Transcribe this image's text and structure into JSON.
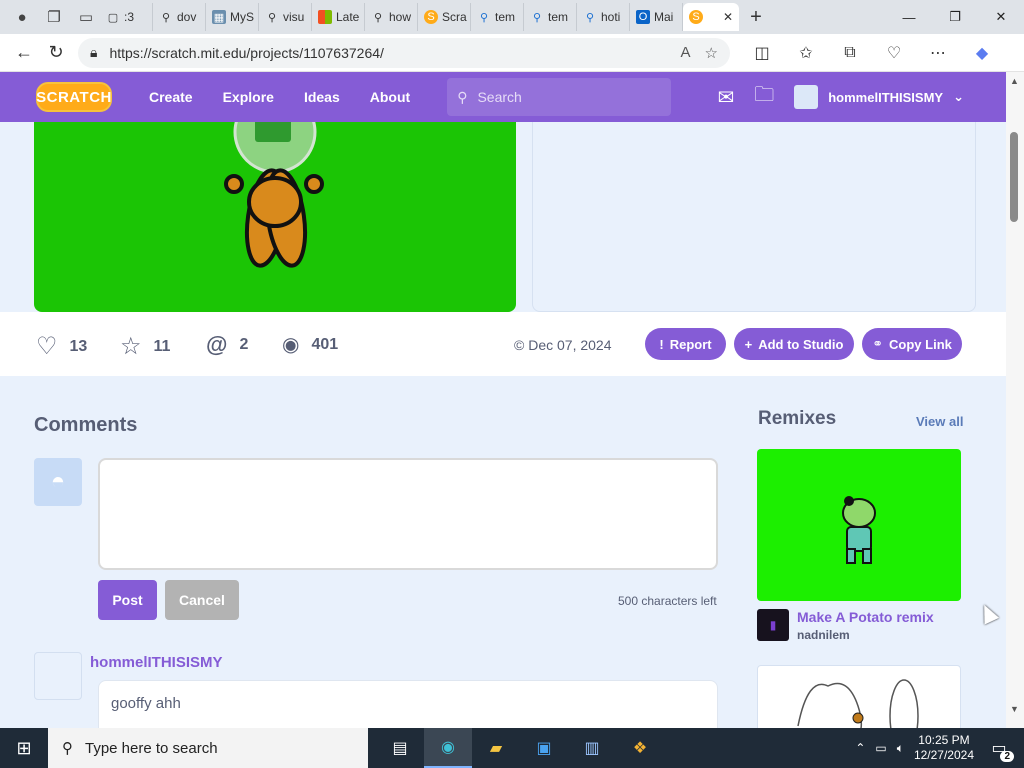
{
  "browser": {
    "tabs": [
      {
        "label": ":3",
        "icon": "page-icon"
      },
      {
        "label": "dov",
        "icon": "search-icon"
      },
      {
        "label": "MyS",
        "icon": "map-icon"
      },
      {
        "label": "visu",
        "icon": "search-icon"
      },
      {
        "label": "Late",
        "icon": "windows-icon"
      },
      {
        "label": "how",
        "icon": "search-icon"
      },
      {
        "label": "Scra",
        "icon": "scratch-icon"
      },
      {
        "label": "tem",
        "icon": "search-icon"
      },
      {
        "label": "tem",
        "icon": "search-icon"
      },
      {
        "label": "hoti",
        "icon": "search-icon"
      },
      {
        "label": "Mai",
        "icon": "outlook-icon"
      }
    ],
    "url": "https://scratch.mit.edu/projects/1107637264/"
  },
  "scratch_nav": {
    "logo": "SCRATCH",
    "links": [
      "Create",
      "Explore",
      "Ideas",
      "About"
    ],
    "search_placeholder": "Search",
    "username": "hommelITHISISMY"
  },
  "stats": {
    "loves": "13",
    "favorites": "11",
    "remixes": "2",
    "views": "401",
    "date": "Dec 07, 2024"
  },
  "actions": {
    "report": "Report",
    "add_to_studio": "Add to Studio",
    "copy_link": "Copy Link"
  },
  "comments": {
    "title": "Comments",
    "post": "Post",
    "cancel": "Cancel",
    "chars_left": "500 characters left",
    "items": [
      {
        "user": "hommelITHISISMY",
        "text": "gooffy ahh"
      }
    ]
  },
  "remixes": {
    "title": "Remixes",
    "view_all": "View all",
    "items": [
      {
        "title": "Make A Potato remix",
        "author": "nadnilem"
      }
    ]
  },
  "taskbar": {
    "search_placeholder": "Type here to search",
    "time": "10:25 PM",
    "date": "12/27/2024",
    "notifications": "2"
  },
  "colors": {
    "scratch_purple": "#855cd6",
    "stage_green": "#1bc505",
    "remix_green": "#1cef00"
  }
}
